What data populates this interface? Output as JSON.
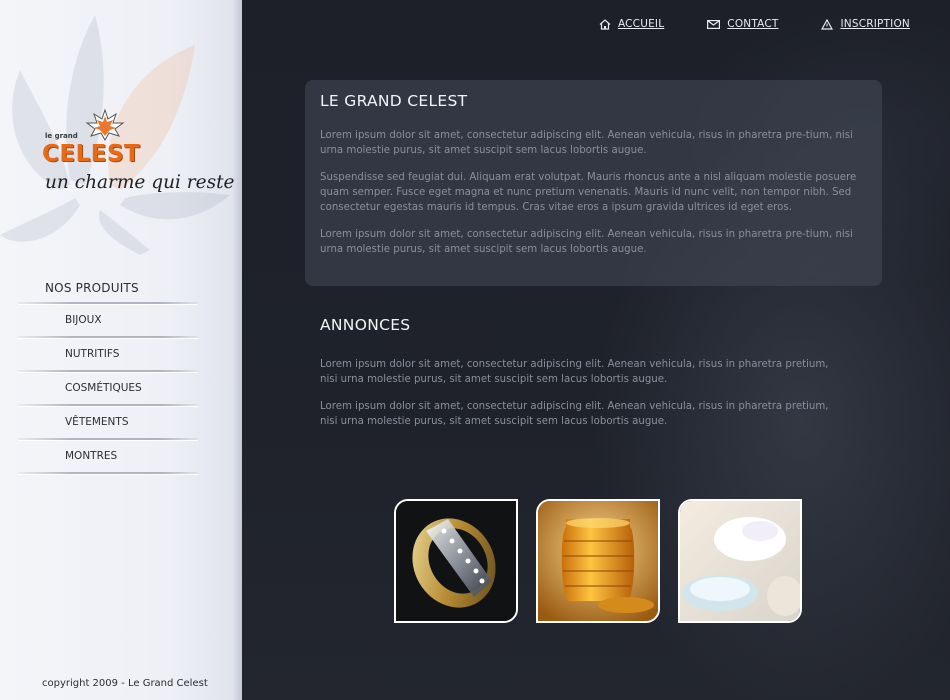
{
  "brand": {
    "small": "le grand",
    "name": "CELEST",
    "tagline": "un charme qui reste"
  },
  "sidebar": {
    "heading": "NOS PRODUITS",
    "items": [
      {
        "label": "BIJOUX"
      },
      {
        "label": "NUTRITIFS"
      },
      {
        "label": "COSMÉTIQUES"
      },
      {
        "label": "VÊTEMENTS"
      },
      {
        "label": "MONTRES"
      }
    ],
    "copyright": "copyright 2009 - Le Grand Celest"
  },
  "topnav": [
    {
      "label": "ACCUEIL",
      "icon": "home-icon"
    },
    {
      "label": "CONTACT",
      "icon": "envelope-icon"
    },
    {
      "label": "INSCRIPTION",
      "icon": "triangle-icon"
    }
  ],
  "intro": {
    "title": "LE GRAND CELEST",
    "paragraphs": [
      "Lorem ipsum dolor sit amet, consectetur adipiscing elit. Aenean vehicula, risus in pharetra pre-tium, nisi urna molestie purus, sit amet suscipit sem lacus lobortis augue.",
      "Suspendisse sed feugiat dui. Aliquam erat volutpat. Mauris rhoncus ante a nisl aliquam molestie posuere quam semper. Fusce eget magna et nunc pretium venenatis. Mauris id nunc velit, non tempor nibh. Sed consectetur egestas mauris id tempus. Cras vitae eros a ipsum gravida ultrices id eget eros.",
      "Lorem ipsum dolor sit amet, consectetur adipiscing elit. Aenean vehicula, risus in pharetra pre-tium, nisi urna molestie purus, sit amet suscipit sem lacus lobortis augue."
    ]
  },
  "annonces": {
    "title": "ANNONCES",
    "paragraphs": [
      "Lorem ipsum dolor sit amet, consectetur adipiscing elit. Aenean vehicula, risus in pharetra pretium, nisi urna molestie purus, sit amet suscipit sem lacus lobortis augue.",
      "Lorem ipsum dolor sit amet, consectetur adipiscing elit. Aenean vehicula, risus in pharetra pretium, nisi urna molestie purus, sit amet suscipit sem lacus lobortis augue."
    ]
  },
  "thumbnails": [
    {
      "name": "ring-thumbnail"
    },
    {
      "name": "honey-thumbnail"
    },
    {
      "name": "cream-thumbnail"
    }
  ],
  "colors": {
    "brand_orange": "#e66a17",
    "main_bg": "#1d2029",
    "panel_bg": "#3c404c",
    "body_text": "#8a8f9d"
  }
}
